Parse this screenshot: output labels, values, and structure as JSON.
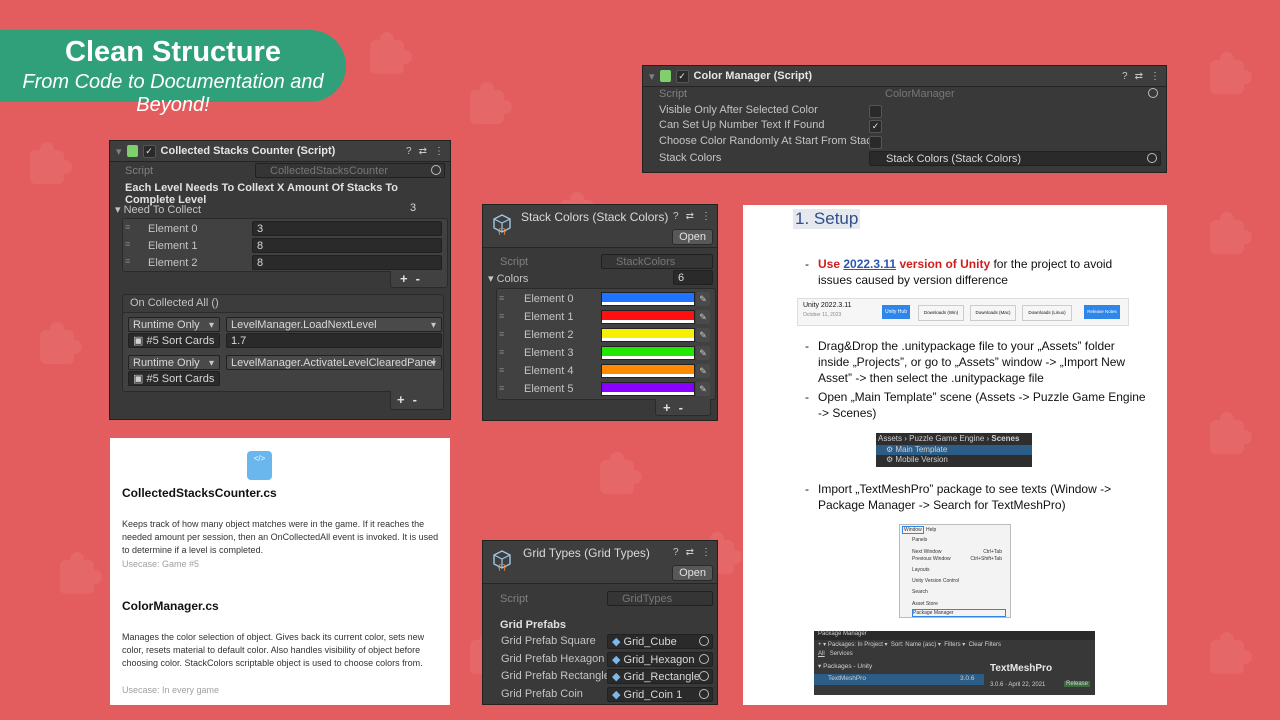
{
  "colors": {
    "background": "#e35d5e",
    "badge": "#2fa07a",
    "panel": "#393939"
  },
  "header": {
    "title": "Clean Structure",
    "subtitle": "From Code to Documentation and Beyond!"
  },
  "collected": {
    "title": "Collected Stacks Counter (Script)",
    "script_label": "Script",
    "script_value": "CollectedStacksCounter",
    "heading": "Each Level Needs To Collext X Amount Of Stacks To Complete Level",
    "need_label": "Need To Collect",
    "need_value": "3",
    "elements": [
      {
        "label": "Element 0",
        "value": "3"
      },
      {
        "label": "Element 1",
        "value": "8"
      },
      {
        "label": "Element 2",
        "value": "8"
      }
    ],
    "event_label": "On Collected All ()",
    "events": [
      {
        "mode": "Runtime Only",
        "func": "LevelManager.LoadNextLevel",
        "obj": "#5 Sort Cards",
        "arg": "1.7"
      },
      {
        "mode": "Runtime Only",
        "func": "LevelManager.ActivateLevelClearedPanel",
        "obj": "#5 Sort Cards",
        "arg": ""
      }
    ],
    "plus": "+",
    "minus": "-"
  },
  "color_manager": {
    "title": "Color Manager (Script)",
    "rows": [
      {
        "label": "Script",
        "value": "ColorManager"
      },
      {
        "label": "Visible Only After Selected Color",
        "value": ""
      },
      {
        "label": "Can Set Up Number Text If Found",
        "value": "✓"
      },
      {
        "label": "Choose Color Randomly At Start From Stack",
        "value": ""
      },
      {
        "label": "Stack Colors",
        "value": "Stack Colors (Stack Colors)"
      }
    ]
  },
  "stack_colors": {
    "title": "Stack Colors (Stack Colors)",
    "open": "Open",
    "script_label": "Script",
    "script_value": "StackColors",
    "colors_label": "Colors",
    "colors_count": "6",
    "elements": [
      {
        "label": "Element 0",
        "color": "#1e74ff"
      },
      {
        "label": "Element 1",
        "color": "#ff1010"
      },
      {
        "label": "Element 2",
        "color": "#f6f000"
      },
      {
        "label": "Element 3",
        "color": "#22e600"
      },
      {
        "label": "Element 4",
        "color": "#ff8a00"
      },
      {
        "label": "Element 5",
        "color": "#8a00ff"
      }
    ]
  },
  "grid_types": {
    "title": "Grid Types (Grid Types)",
    "open": "Open",
    "script_label": "Script",
    "script_value": "GridTypes",
    "section": "Grid Prefabs",
    "rows": [
      {
        "label": "Grid Prefab Square",
        "value": "Grid_Cube"
      },
      {
        "label": "Grid Prefab Hexagon",
        "value": "Grid_Hexagon"
      },
      {
        "label": "Grid Prefab Rectangle",
        "value": "Grid_Rectangle"
      },
      {
        "label": "Grid Prefab Coin",
        "value": "Grid_Coin 1"
      }
    ]
  },
  "docs": {
    "icon_label": "</>",
    "a_title": "CollectedStacksCounter.cs",
    "a_text": "Keeps track of how many object matches were in the game. If it reaches the needed amount per session, then an OnCollectedAll event is invoked. It is used to determine if a level is completed.",
    "a_usecase": "Usecase: Game #5",
    "b_title": "ColorManager.cs",
    "b_text": "Manages the color selection of object. Gives back its current color, sets new color, resets material to default color. Also handles visibility of object before choosing color. StackColors scriptable object is used to choose colors from.",
    "b_usecase": "Usecase: In every game"
  },
  "setup": {
    "heading": "1. Setup",
    "s1_use": "Use",
    "s1_version": "2022.3.11",
    "s1_rest": "version of Unity",
    "s1_tail": "for the project to avoid issues caused by version difference",
    "unity_ver": "Unity 2022.3.11",
    "unity_date": "October 11, 2023",
    "hub": "Unity Hub",
    "dl_win": "Downloads (Win)",
    "dl_mac": "Downloads (Mac)",
    "dl_linux": "Downloads (Linux)",
    "release": "Release Notes",
    "s2": "Drag&Drop the .unitypackage file to your „Assets” folder inside „Projects”, or go to „Assets” window -> „Import New Asset” -> then select the .unitypackage file",
    "s3": "Open „Main Template” scene (Assets -> Puzzle Game Engine -> Scenes)",
    "crumb_assets": "Assets",
    "crumb_engine": "Puzzle Game Engine",
    "crumb_scenes": "Scenes",
    "scene1": "Main Template",
    "scene2": "Mobile Version",
    "s4": "Import „TextMeshPro” package to see texts (Window -> Package Manager -> Search for TextMeshPro)",
    "menu_window": "Window",
    "menu_help": "Help",
    "menu_items": [
      "Panels",
      "Next Window",
      "Previous Window",
      "Layouts",
      "Unity Version Control",
      "Search",
      "Asset Store",
      "Package Manager"
    ],
    "menu_keys": [
      "",
      "Ctrl+Tab",
      "Ctrl+Shift+Tab",
      "",
      "",
      "",
      "",
      ""
    ],
    "pm_title": "Package Manager",
    "pm_packages": "Packages: In Project",
    "pm_sort": "Sort: Name (asc)",
    "pm_filters": "Filters",
    "pm_clear": "Clear Filters",
    "pm_all": "All",
    "pm_services": "Services",
    "pm_group": "Packages - Unity",
    "pm_item": "TextMeshPro",
    "pm_item_ver": "3.0.6",
    "pm_name": "TextMeshPro",
    "pm_detail": "3.0.6 · April 22, 2021",
    "pm_release": "Release"
  }
}
